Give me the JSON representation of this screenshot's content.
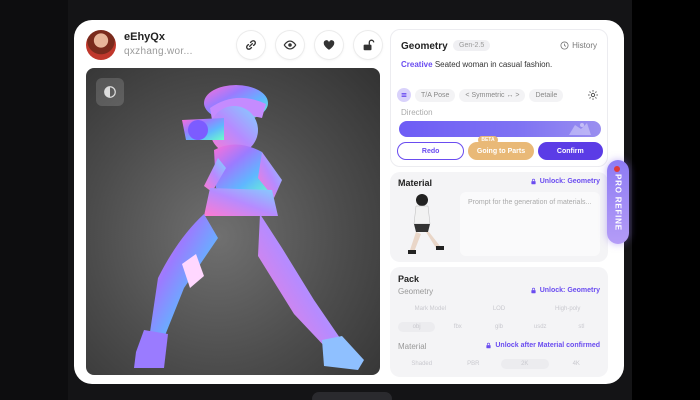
{
  "user": {
    "name": "eEhyQx",
    "handle": "qxzhang.wor..."
  },
  "geometry": {
    "title": "Geometry",
    "version": "Gen-2.5",
    "history_label": "History",
    "prompt_tag": "Creative",
    "prompt_text": "Seated woman in casual fashion.",
    "options": [
      "T/A Pose",
      "< Symmetric ↔ >",
      "Detaile"
    ],
    "direction_label": "Direction",
    "redo_label": "Redo",
    "parts_label": "Going to Parts",
    "parts_badge": "BETA",
    "confirm_label": "Confirm"
  },
  "material": {
    "title": "Material",
    "unlock_label": "Unlock: Geometry",
    "prompt_placeholder": "Prompt for the generation of materials..."
  },
  "pack": {
    "title": "Pack",
    "geometry_label": "Geometry",
    "geometry_unlock": "Unlock: Geometry",
    "geometry_options": [
      "Mark Model",
      "LOD",
      "High-poly"
    ],
    "formats": [
      "obj",
      "fbx",
      "glb",
      "usdz",
      "stl"
    ],
    "material_label": "Material",
    "material_unlock": "Unlock after Material confirmed",
    "material_options": [
      "Shaded",
      "PBR",
      "2K",
      "4K"
    ]
  },
  "pro_refine_label": "PRO REFINE",
  "colors": {
    "accent": "#5b3ce6",
    "parts": "#e9b977",
    "accent_light": "#6a4cf0"
  }
}
